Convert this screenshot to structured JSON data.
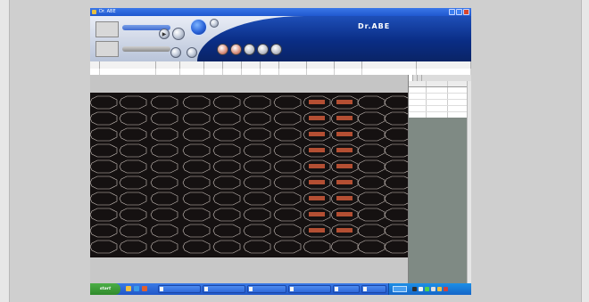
{
  "window": {
    "title": "Dr. ABE"
  },
  "toolbar": {
    "logo": "Dr.ABE",
    "slider1_label": "",
    "slider2_label": "",
    "round_buttons": [
      "",
      "",
      "",
      "",
      ""
    ]
  },
  "table": {
    "headers": [
      "",
      "",
      "",
      "",
      "",
      "",
      "",
      "",
      "",
      "",
      "",
      "",
      ""
    ],
    "row": [
      "",
      "",
      "",
      "",
      "",
      "",
      "",
      "",
      "",
      "",
      "",
      "",
      ""
    ]
  },
  "panel": {
    "tabs": [
      "",
      "",
      ""
    ],
    "headers": [
      "",
      "",
      ""
    ],
    "rows": [
      [
        "",
        "",
        ""
      ],
      [
        "",
        "",
        ""
      ],
      [
        "",
        "",
        ""
      ],
      [
        "",
        "",
        ""
      ],
      [
        "",
        "",
        ""
      ],
      [
        "",
        "",
        ""
      ]
    ]
  },
  "taskbar": {
    "start_label": "start",
    "tasks": [
      "",
      "",
      "",
      "",
      "",
      ""
    ],
    "clock": ""
  },
  "colors": {
    "canvas": "#151111",
    "part_outline": "#cfc6c0",
    "highlight": "#d05a3a",
    "brand_blue": "#0b2f7d"
  }
}
